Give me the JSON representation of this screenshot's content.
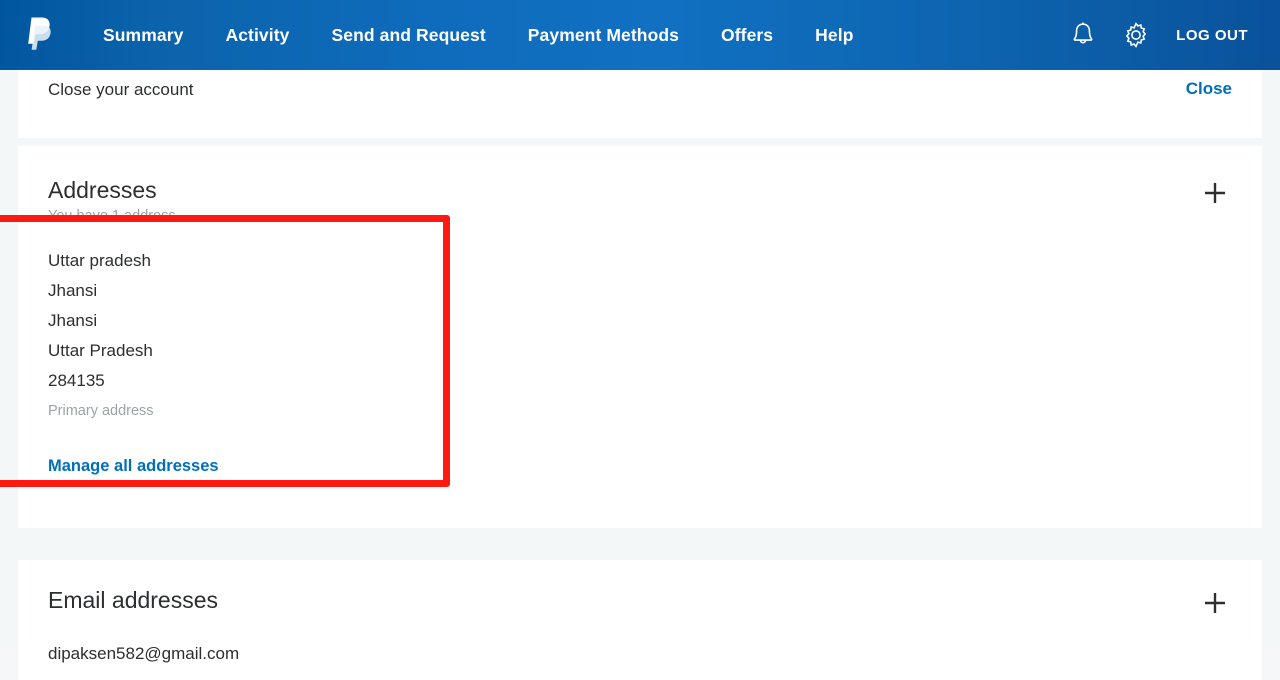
{
  "navbar": {
    "logo_icon": "paypal-logo-icon",
    "links": [
      {
        "label": "Summary"
      },
      {
        "label": "Activity"
      },
      {
        "label": "Send and Request"
      },
      {
        "label": "Payment Methods"
      },
      {
        "label": "Offers"
      },
      {
        "label": "Help"
      }
    ],
    "notifications_icon": "bell-icon",
    "settings_icon": "gear-icon",
    "logout_label": "LOG OUT",
    "background_start": "#00579f",
    "background_mid": "#1170c2",
    "background_end": "#0a529b"
  },
  "settings_tail": {
    "close_account_label": "Close your account",
    "close_action_label": "Close",
    "close_action_color": "#0070ba"
  },
  "addresses": {
    "title": "Addresses",
    "subtitle": "You have 1 address.",
    "add_icon": "plus-icon",
    "lines": [
      "Uttar pradesh",
      "Jhansi",
      "Jhansi",
      "Uttar Pradesh",
      "284135"
    ],
    "primary_label": "Primary address",
    "manage_link_label": "Manage all addresses",
    "manage_link_color": "#0070ba"
  },
  "emails": {
    "title": "Email addresses",
    "add_icon": "plus-icon",
    "address": "dipaksen582@gmail.com"
  },
  "annotation": {
    "highlight_color": "#fc1a13",
    "target": "addresses-card-detail"
  }
}
